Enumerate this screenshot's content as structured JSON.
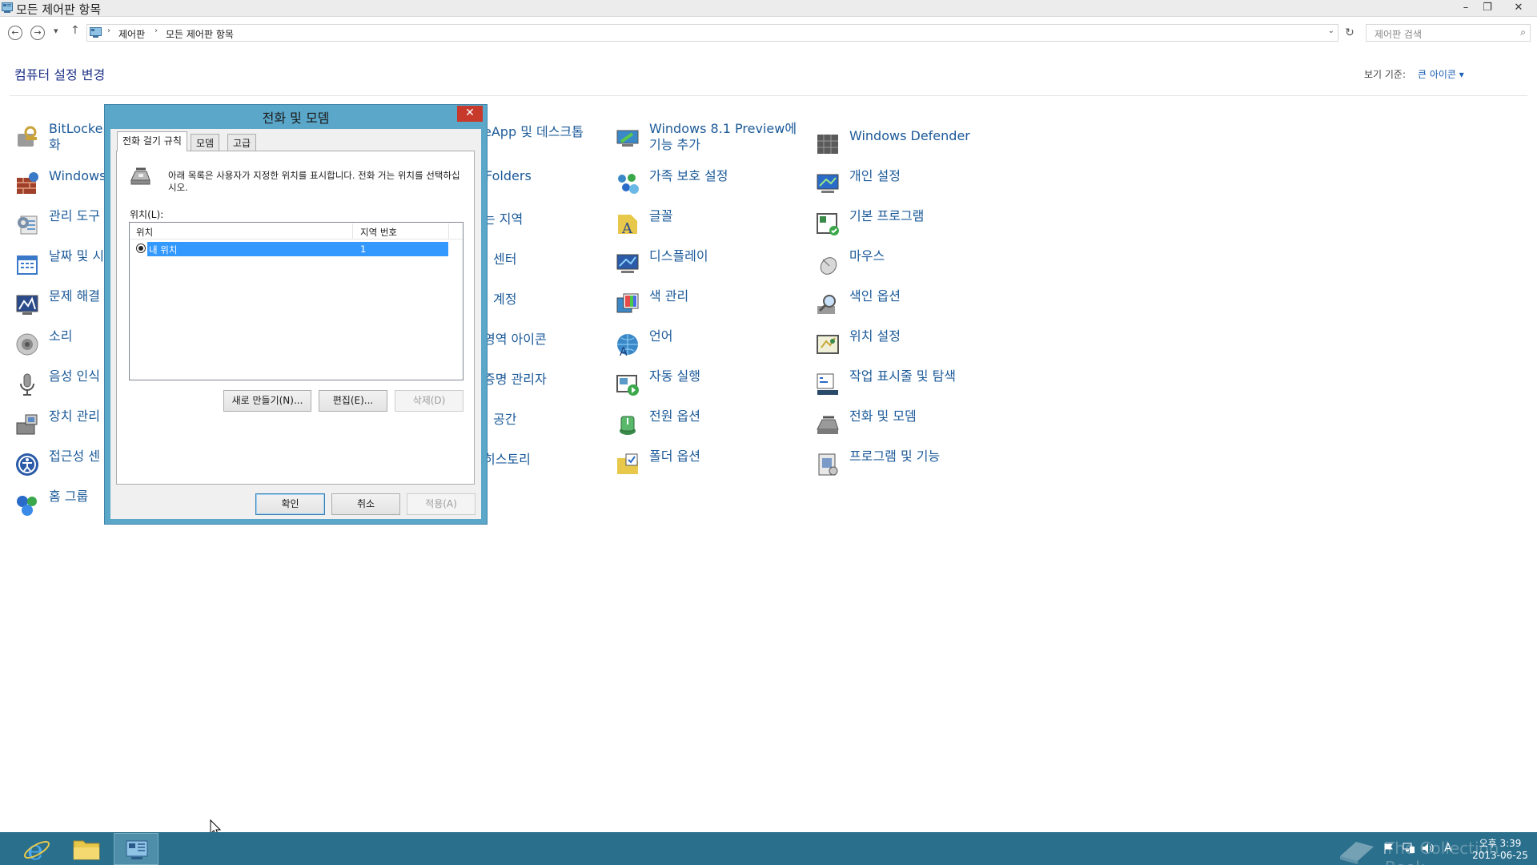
{
  "window": {
    "title": "모든 제어판 항목",
    "min": "–",
    "restore": "❐",
    "close": "✕"
  },
  "navbar": {
    "back": "←",
    "forward": "→",
    "recent": "▾",
    "up": "↑",
    "breadcrumbs": [
      "제어판",
      "모든 제어판 항목"
    ],
    "sep": "›",
    "dropdown": "⌄",
    "refresh": "↻",
    "search_placeholder": "제어판 검색",
    "search_icon": "⌕"
  },
  "header": {
    "title": "컴퓨터 설정 변경",
    "view_label": "보기 기준:",
    "view_value": "큰 아이콘 ▾"
  },
  "items": {
    "col1": [
      "BitLocker",
      "화",
      "Windows",
      "관리 도구",
      "날짜 및 시",
      "문제 해결",
      "소리",
      "음성 인식",
      "장치 관리",
      "접근성 센",
      "홈 그룹"
    ],
    "col2": [
      "eApp 및 데스크톱",
      "Folders",
      "는 지역",
      "센터",
      "계정",
      "영역 아이콘",
      "증명 관리자",
      "공간",
      "히스토리"
    ],
    "col3": [
      "Windows 8.1 Preview에",
      "기능 추가",
      "가족 보호 설정",
      "글꼴",
      "디스플레이",
      "색 관리",
      "언어",
      "자동 실행",
      "전원 옵션",
      "폴더 옵션"
    ],
    "col4": [
      "Windows Defender",
      "개인 설정",
      "기본 프로그램",
      "마우스",
      "색인 옵션",
      "위치 설정",
      "작업 표시줄 및 탐색",
      "전화 및 모뎀",
      "프로그램 및 기능"
    ]
  },
  "dialog": {
    "title": "전화 및 모뎀",
    "close": "✕",
    "tabs": [
      "전화 걸기 규칙",
      "모뎀",
      "고급"
    ],
    "description": "아래 목록은 사용자가 지정한 위치를 표시합니다. 전화 거는 위치를 선택하십시오.",
    "locations_label": "위치(L):",
    "columns": [
      "위치",
      "지역 번호"
    ],
    "rows": [
      {
        "name": "내 위치",
        "area": "1"
      }
    ],
    "buttons": {
      "new": "새로 만들기(N)...",
      "edit": "편집(E)...",
      "delete": "삭제(D)",
      "ok": "확인",
      "cancel": "취소",
      "apply": "적용(A)"
    }
  },
  "taskbar": {
    "watermark": "The Collection Book",
    "clock_time": "오후 3:39",
    "clock_date": "2013-06-25",
    "ime": "A"
  }
}
